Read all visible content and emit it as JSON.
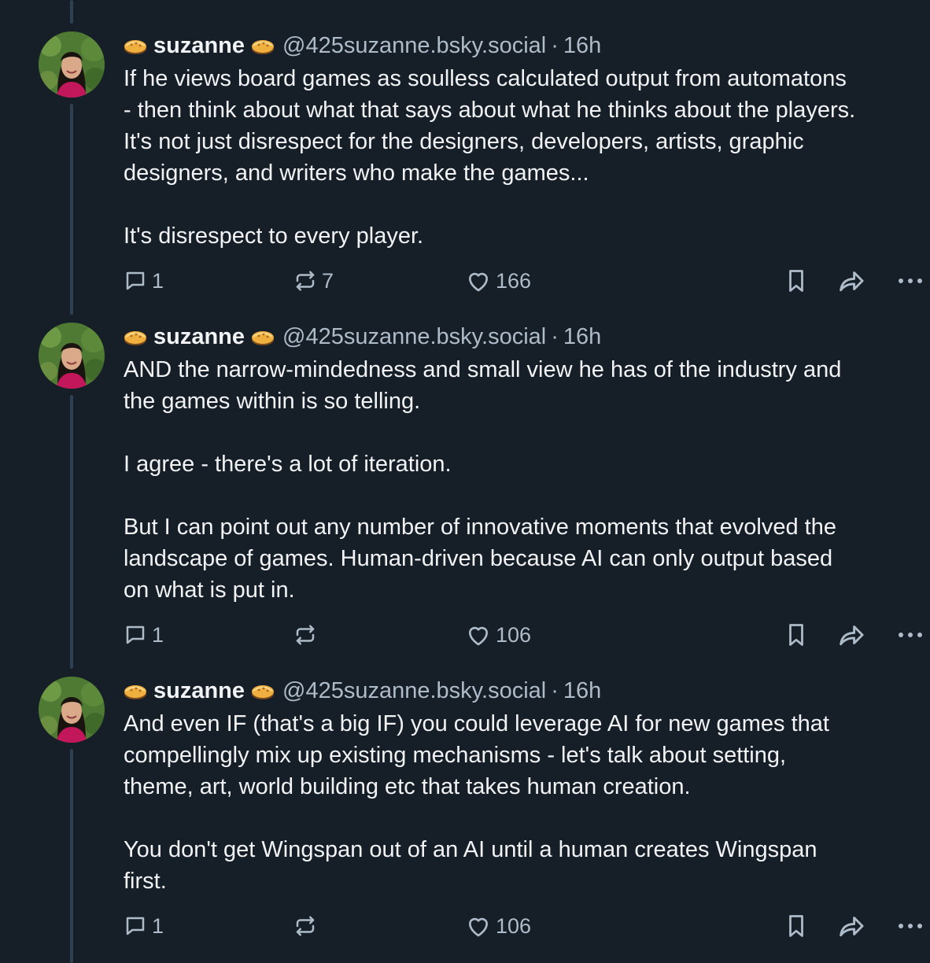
{
  "posts": [
    {
      "display_name": "suzanne",
      "emoji": "pie",
      "handle": "@425suzanne.bsky.social",
      "separator": "·",
      "time": "16h",
      "lines": [
        "If he views board games as soulless calculated output from automatons",
        "- then think about what that says about what he thinks about the players.",
        "It's not just disrespect for the designers, developers, artists, graphic",
        "designers, and writers who make the games...",
        "",
        "It's disrespect to every player."
      ],
      "replies": "1",
      "reposts": "7",
      "likes": "166"
    },
    {
      "display_name": "suzanne",
      "emoji": "pie",
      "handle": "@425suzanne.bsky.social",
      "separator": "·",
      "time": "16h",
      "lines": [
        "AND the narrow-mindedness and small view he has of the industry and",
        "the games within is so telling.",
        "",
        "I agree - there's a lot of iteration.",
        "",
        "But I can point out any number of innovative moments that evolved the",
        "landscape of games. Human-driven because AI can only output based",
        "on what is put in."
      ],
      "replies": "1",
      "reposts": "",
      "likes": "106"
    },
    {
      "display_name": "suzanne",
      "emoji": "pie",
      "handle": "@425suzanne.bsky.social",
      "separator": "·",
      "time": "16h",
      "lines": [
        "And even IF (that's a big IF) you could leverage AI for new games that",
        "compellingly mix up existing mechanisms - let's talk about setting,",
        "theme, art, world building etc that takes human creation.",
        "",
        "You don't get Wingspan out of an AI until a human creates Wingspan",
        "first."
      ],
      "replies": "1",
      "reposts": "",
      "likes": "106"
    }
  ],
  "icons": {
    "reply": "speech-bubble-icon",
    "repost": "repost-arrows-icon",
    "like": "heart-icon",
    "bookmark": "bookmark-icon",
    "share": "share-arrow-icon",
    "more": "more-dots-icon"
  },
  "colors": {
    "background": "#161e27",
    "text": "#f1f3f5",
    "muted": "#aebbc9",
    "thread_line": "#2e4052"
  }
}
